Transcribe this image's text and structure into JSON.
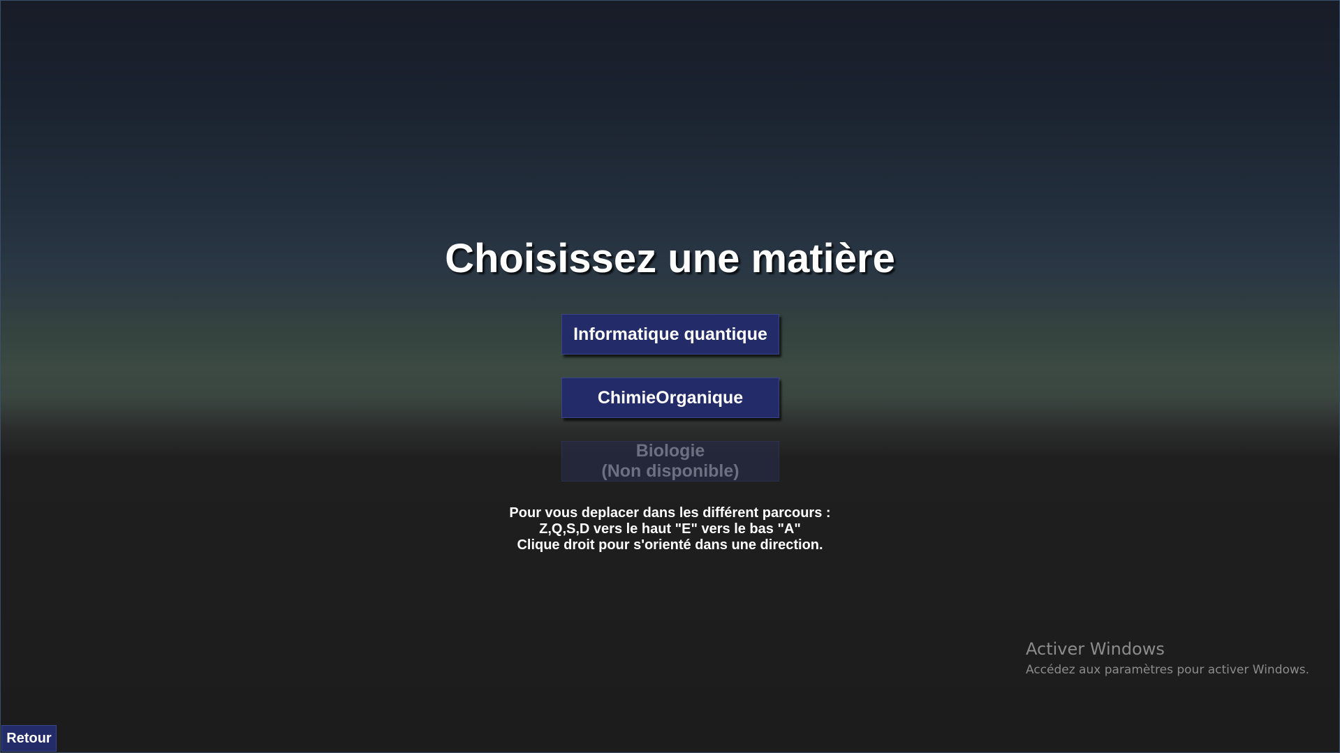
{
  "menu": {
    "title": "Choisissez une matière",
    "buttons": {
      "quantum": "Informatique quantique",
      "chimie": "ChimieOrganique",
      "bio_line1": "Biologie",
      "bio_line2": "(Non disponible)"
    },
    "instructions": [
      "Pour vous deplacer dans les différent parcours :",
      "Z,Q,S,D vers le haut \"E\" vers le bas \"A\"",
      "Clique droit pour s'orienté dans une direction."
    ],
    "back_label": "Retour"
  },
  "watermark": {
    "title": "Activer Windows",
    "subtitle": "Accédez aux paramètres pour activer Windows."
  },
  "colors": {
    "button_bg": "#232b69",
    "disabled_text": "#6d7080",
    "watermark_text": "#8c8c8c"
  }
}
